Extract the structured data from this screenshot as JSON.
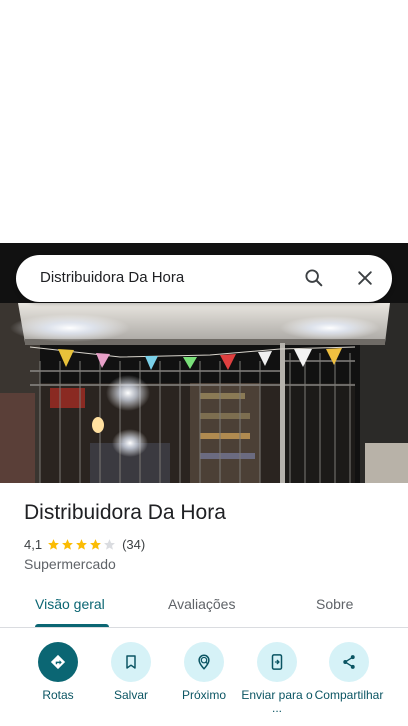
{
  "search": {
    "query": "Distribuidora Da Hora"
  },
  "place": {
    "name": "Distribuidora Da Hora",
    "rating": "4,1",
    "rating_value": 4.1,
    "review_count": "(34)",
    "category": "Supermercado"
  },
  "tabs": [
    {
      "label": "Visão geral",
      "active": true
    },
    {
      "label": "Avaliações",
      "active": false
    },
    {
      "label": "Sobre",
      "active": false
    }
  ],
  "actions": [
    {
      "label": "Rotas",
      "icon": "directions-icon"
    },
    {
      "label": "Salvar",
      "icon": "bookmark-icon"
    },
    {
      "label": "Próximo",
      "icon": "nearby-icon"
    },
    {
      "label": "Enviar para o ...",
      "icon": "send-to-phone-icon"
    },
    {
      "label": "Compartilhar",
      "icon": "share-icon"
    }
  ],
  "colors": {
    "accent": "#0b6673",
    "star": "#fbbc04",
    "star_empty": "#dadce0",
    "chip_bg": "#d6f2f7"
  }
}
